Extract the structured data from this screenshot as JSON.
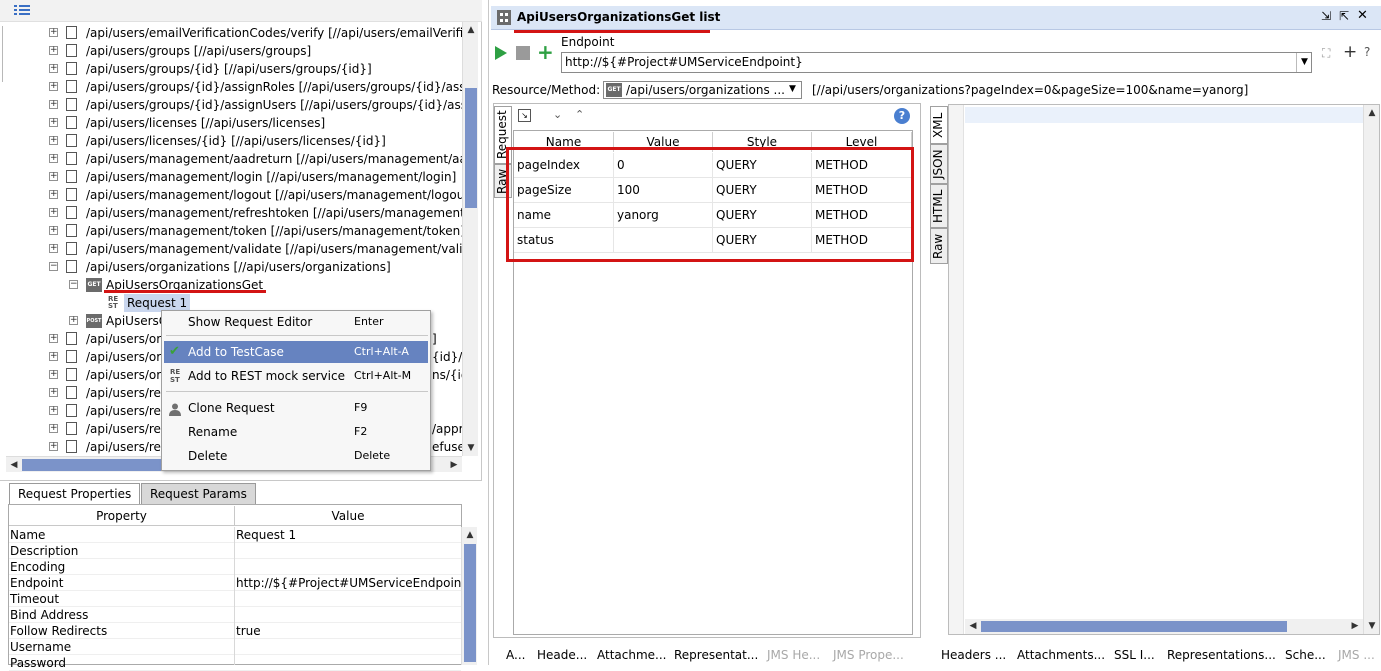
{
  "navigator": {
    "tree": [
      {
        "text": "/api/users/emailVerificationCodes/verify [//api/users/emailVerific"
      },
      {
        "text": "/api/users/groups [//api/users/groups]"
      },
      {
        "text": "/api/users/groups/{id} [//api/users/groups/{id}]"
      },
      {
        "text": "/api/users/groups/{id}/assignRoles [//api/users/groups/{id}/assig"
      },
      {
        "text": "/api/users/groups/{id}/assignUsers [//api/users/groups/{id}/assi"
      },
      {
        "text": "/api/users/licenses [//api/users/licenses]"
      },
      {
        "text": "/api/users/licenses/{id} [//api/users/licenses/{id}]"
      },
      {
        "text": "/api/users/management/aadreturn [//api/users/management/aa"
      },
      {
        "text": "/api/users/management/login [//api/users/management/login]"
      },
      {
        "text": "/api/users/management/logout [//api/users/management/logou"
      },
      {
        "text": "/api/users/management/refreshtoken [//api/users/management/"
      },
      {
        "text": "/api/users/management/token [//api/users/management/token]"
      },
      {
        "text": "/api/users/management/validate [//api/users/management/valid"
      },
      {
        "text": "/api/users/organizations [//api/users/organizations]"
      }
    ],
    "method_label": "ApiUsersOrganizationsGet",
    "method_icon": "GET",
    "request_label": "Request 1",
    "rest_icon": "RE ST",
    "post_method_partial": "ApiUsersO",
    "post_icon": "POST",
    "partial_rows": [
      {
        "left": "/api/users/or",
        "right": "]"
      },
      {
        "left": "/api/users/or",
        "right": "{id}/"
      },
      {
        "left": "/api/users/or",
        "right": "ns/{id"
      },
      {
        "left": "/api/users/re",
        "right": ""
      },
      {
        "left": "/api/users/re",
        "right": ""
      },
      {
        "left": "/api/users/re",
        "right": "/appr"
      },
      {
        "left": "/api/users/re",
        "right": "efuse]"
      }
    ]
  },
  "context_menu": {
    "items": [
      {
        "label": "Show Request Editor",
        "shortcut": "Enter"
      },
      {
        "label": "Add to TestCase",
        "shortcut": "Ctrl+Alt-A"
      },
      {
        "label": "Add to REST mock service",
        "shortcut": "Ctrl+Alt-M"
      },
      {
        "label": "Clone Request",
        "shortcut": "F9"
      },
      {
        "label": "Rename",
        "shortcut": "F2"
      },
      {
        "label": "Delete",
        "shortcut": "Delete"
      }
    ],
    "highlighted": "Add to TestCase"
  },
  "properties": {
    "tabs": [
      "Request Properties",
      "Request Params"
    ],
    "active_tab": "Request Properties",
    "columns": [
      "Property",
      "Value"
    ],
    "rows": [
      {
        "name": "Name",
        "value": "Request 1"
      },
      {
        "name": "Description",
        "value": ""
      },
      {
        "name": "Encoding",
        "value": ""
      },
      {
        "name": "Endpoint",
        "value": "http://${#Project#UMServiceEndpoint}"
      },
      {
        "name": "Timeout",
        "value": ""
      },
      {
        "name": "Bind Address",
        "value": ""
      },
      {
        "name": "Follow Redirects",
        "value": "true"
      },
      {
        "name": "Username",
        "value": ""
      },
      {
        "name": "Password",
        "value": ""
      }
    ]
  },
  "request_window": {
    "title": "ApiUsersOrganizationsGet list",
    "endpoint_label": "Endpoint",
    "endpoint_value": "http://${#Project#UMServiceEndpoint}",
    "resource_label": "Resource/Method:",
    "resource_method": "/api/users/organizations ...",
    "resource_method_icon": "GET",
    "resolved_url": "[//api/users/organizations?pageIndex=0&pageSize=100&name=yanorg]",
    "left_vtabs": [
      "Request",
      "Raw"
    ],
    "right_vtabs": [
      "XML",
      "JSON",
      "HTML",
      "Raw"
    ],
    "params": {
      "columns": [
        "Name",
        "Value",
        "Style",
        "Level"
      ],
      "rows": [
        {
          "name": "pageIndex",
          "value": "0",
          "style": "QUERY",
          "level": "METHOD"
        },
        {
          "name": "pageSize",
          "value": "100",
          "style": "QUERY",
          "level": "METHOD"
        },
        {
          "name": "name",
          "value": "yanorg",
          "style": "QUERY",
          "level": "METHOD"
        },
        {
          "name": "status",
          "value": "",
          "style": "QUERY",
          "level": "METHOD"
        }
      ]
    },
    "bottom_tabs_request": [
      {
        "label": "A...",
        "dim": false
      },
      {
        "label": "Heade...",
        "dim": false
      },
      {
        "label": "Attachme...",
        "dim": false
      },
      {
        "label": "Representat...",
        "dim": false
      },
      {
        "label": "JMS He...",
        "dim": true
      },
      {
        "label": "JMS Prope...",
        "dim": true
      }
    ],
    "bottom_tabs_response": [
      {
        "label": "Headers ...",
        "dim": false
      },
      {
        "label": "Attachments...",
        "dim": false
      },
      {
        "label": "SSL I...",
        "dim": false
      },
      {
        "label": "Representations...",
        "dim": false
      },
      {
        "label": "Sche...",
        "dim": false
      },
      {
        "label": "JMS ...",
        "dim": true
      }
    ]
  },
  "colors": {
    "highlight": "#6683c0",
    "annotation_red": "#d31414",
    "title_bar": "#dbe6f6",
    "run_green": "#2ea043"
  }
}
